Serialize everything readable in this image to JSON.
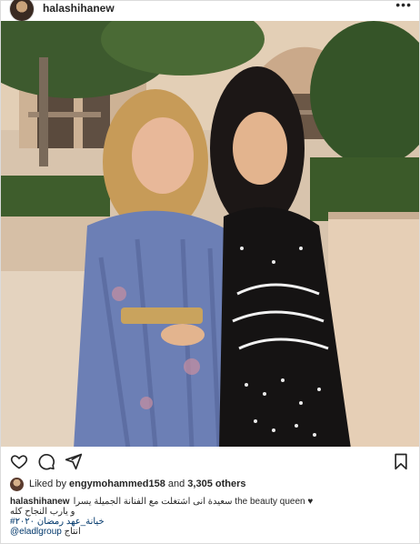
{
  "post": {
    "username": "halashihanew",
    "more_icon": "more-dots-icon",
    "likes": {
      "prefix": "Liked by",
      "liker": "engymohammed158",
      "middle": "and",
      "count": "3,305 others"
    },
    "caption": {
      "username": "halashihanew",
      "line1": "سعيدة انى اشتغلت مع الفنانة الجميلة يسرا the beauty queen ♥︎",
      "line2": "و يارب النجاح كله",
      "hashtags": "#خيانة_عهد رمضان ٢٠٢٠",
      "mention": "@eladlgroup",
      "mention_prefix": "انتاج"
    },
    "actions": [
      "heart-icon",
      "comment-icon",
      "share-icon",
      "bookmark-icon"
    ]
  }
}
